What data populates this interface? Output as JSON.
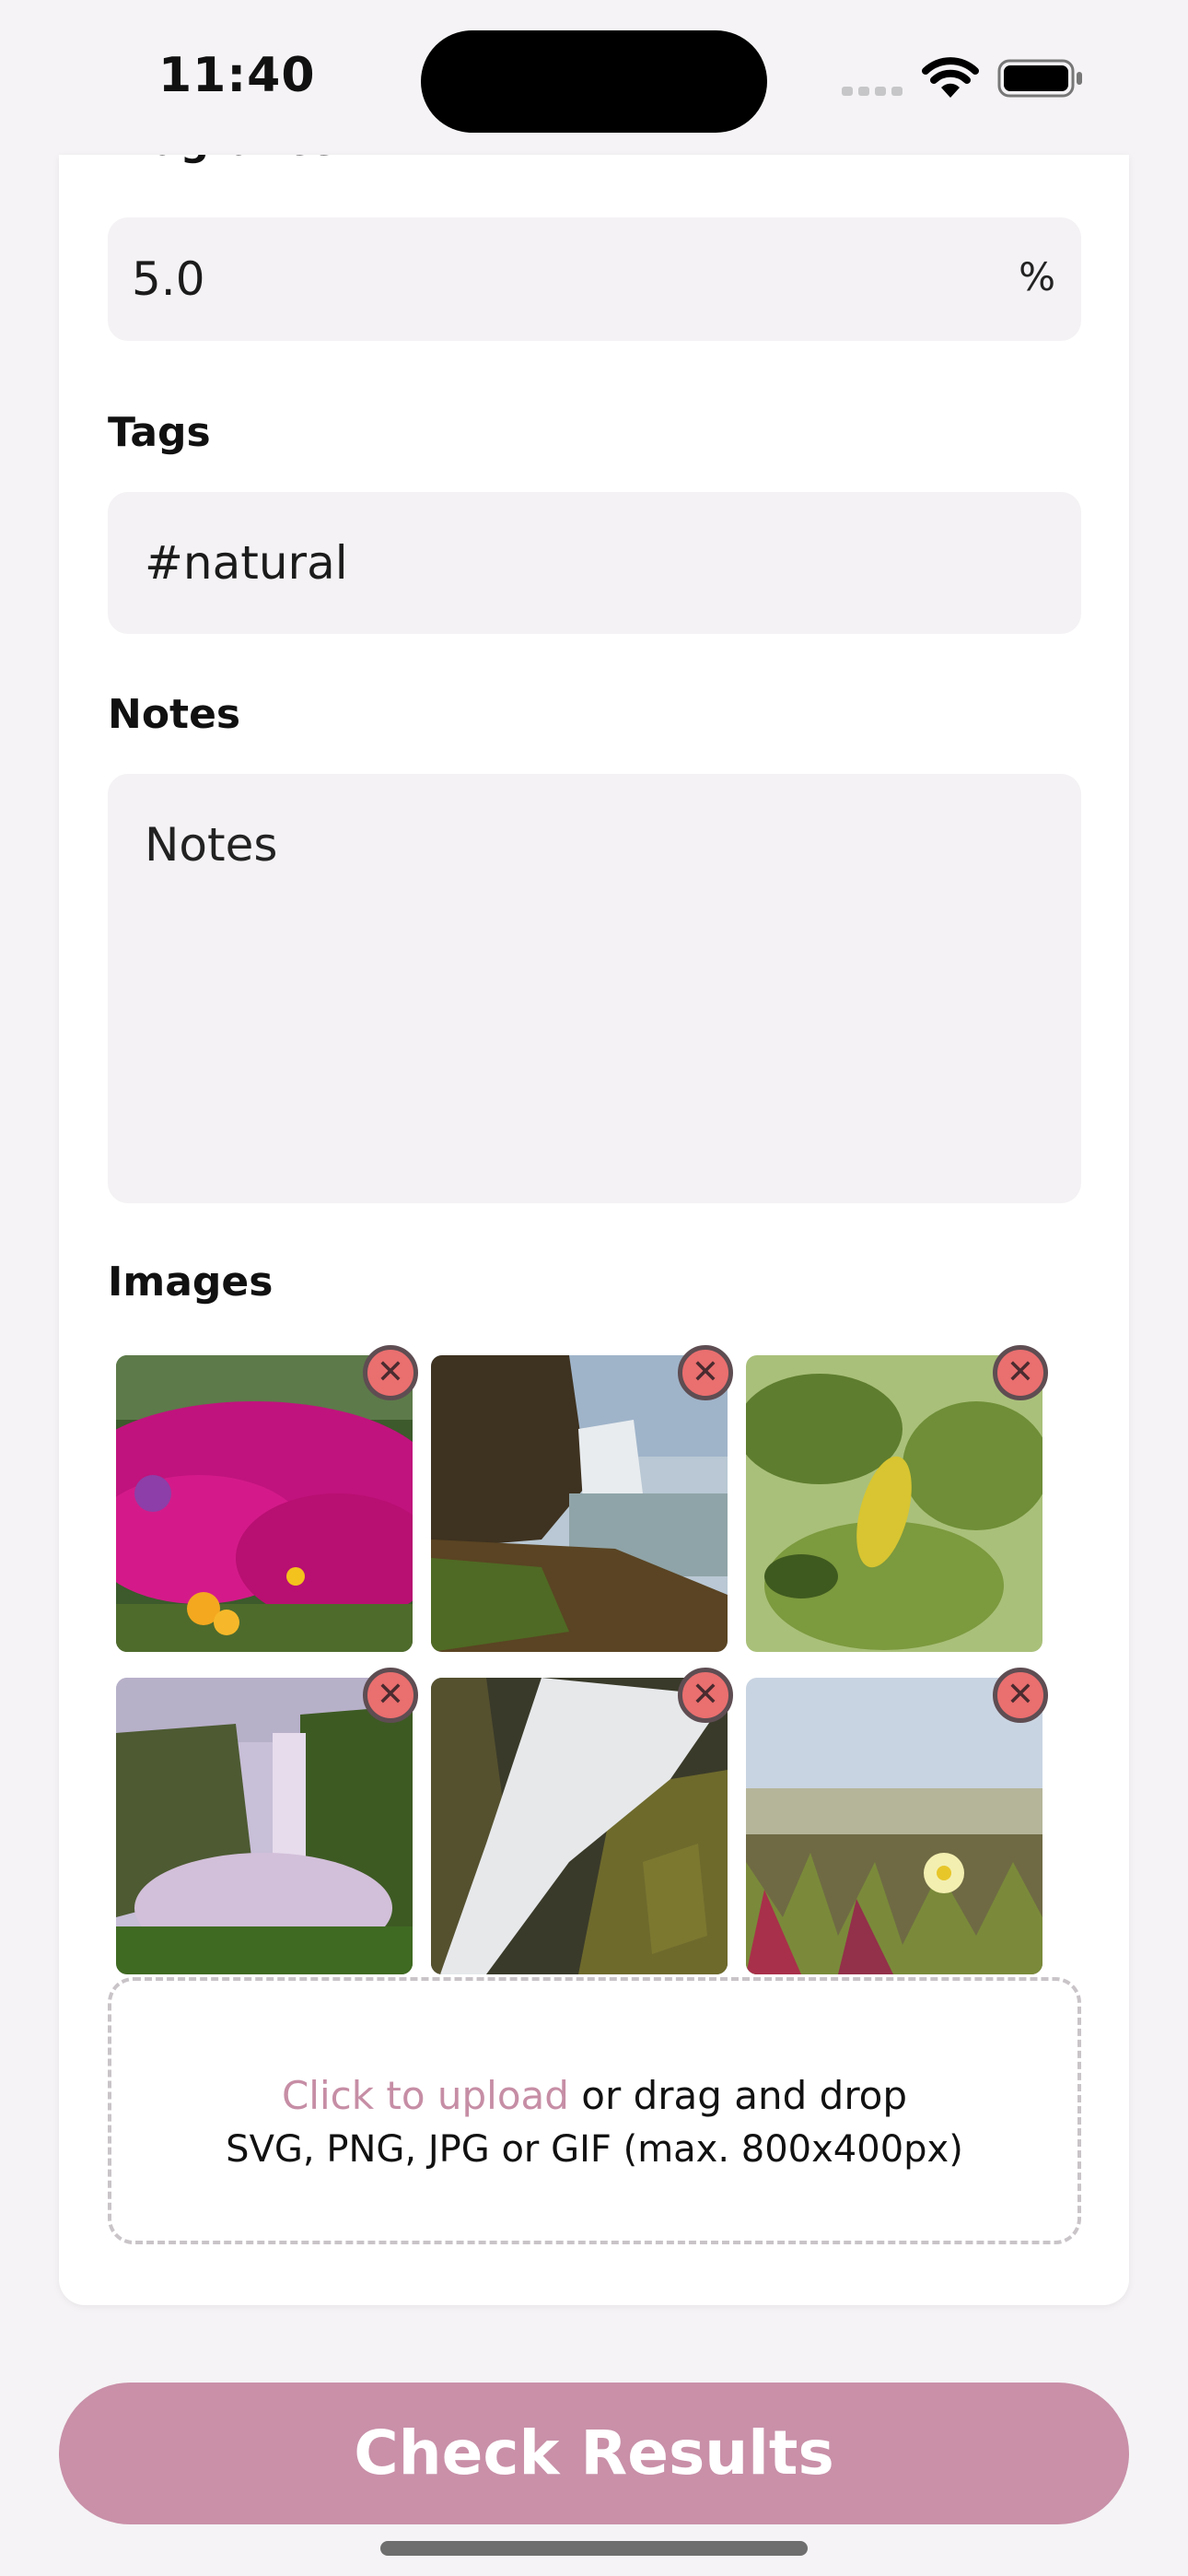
{
  "status_bar": {
    "time": "11:40"
  },
  "form": {
    "cut_off_label": "Fragrance",
    "fragrance": {
      "value": "5.0",
      "suffix": "%"
    },
    "tags": {
      "label": "Tags",
      "value": "#natural"
    },
    "notes": {
      "label": "Notes",
      "placeholder": "Notes"
    },
    "images": {
      "label": "Images",
      "items": [
        {
          "icon": "flowers-photo",
          "remove_glyph": "✕"
        },
        {
          "icon": "waterfall-coast-photo",
          "remove_glyph": "✕"
        },
        {
          "icon": "leaves-photo",
          "remove_glyph": "✕"
        },
        {
          "icon": "waterfall-valley-photo",
          "remove_glyph": "✕"
        },
        {
          "icon": "waterfall-closeup-photo",
          "remove_glyph": "✕"
        },
        {
          "icon": "succulent-flower-photo",
          "remove_glyph": "✕"
        }
      ]
    },
    "upload": {
      "link_text": "Click to upload",
      "rest_text": " or drag and drop",
      "hint": "SVG, PNG, JPG or GIF (max. 800x400px)"
    }
  },
  "cta": {
    "label": "Check Results"
  },
  "colors": {
    "accent": "#c990a8",
    "remove": "#ea6f6f"
  }
}
